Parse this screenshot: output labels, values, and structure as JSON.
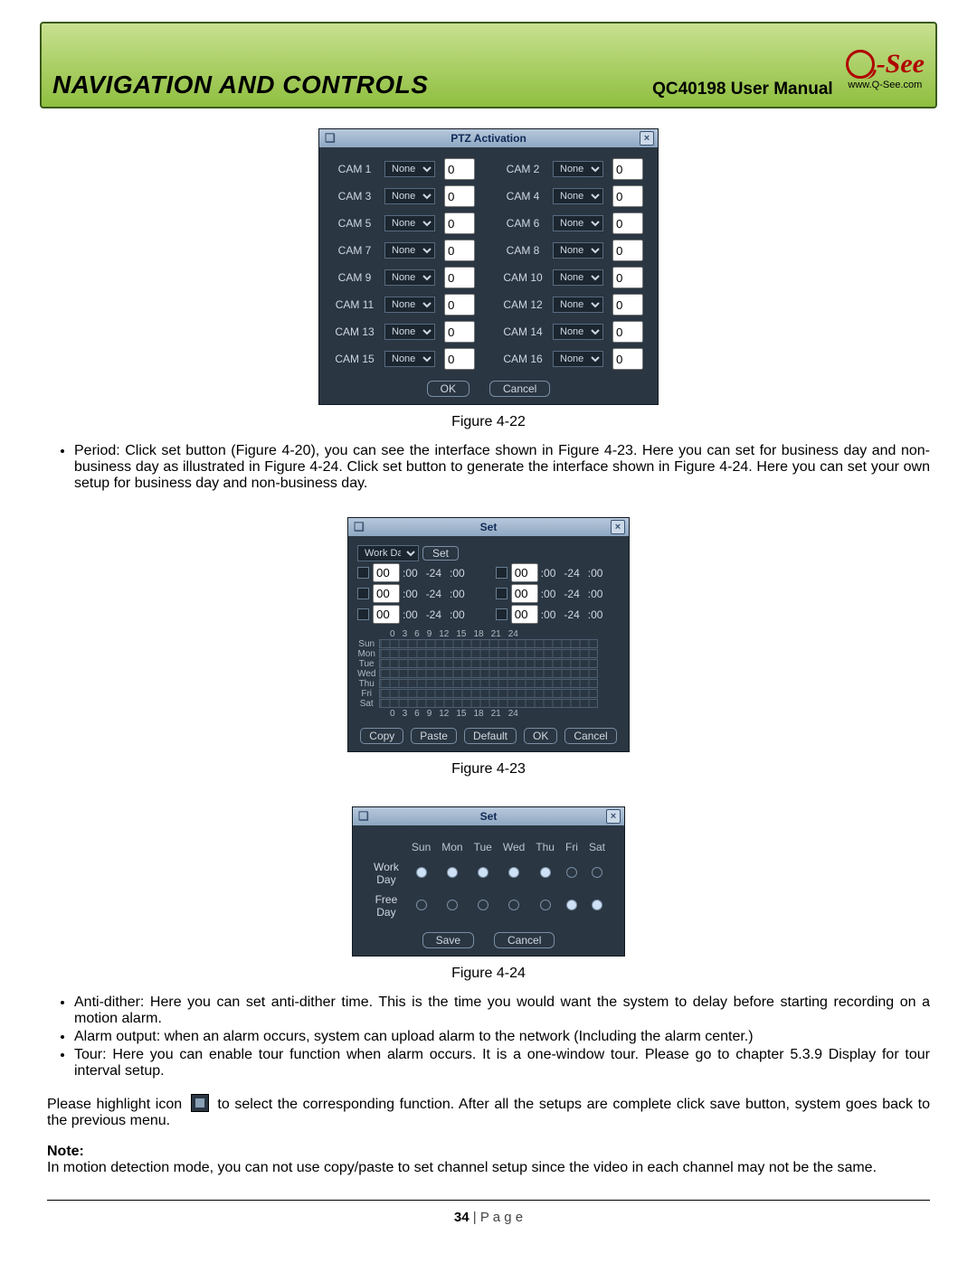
{
  "header": {
    "title": "NAVIGATION AND CONTROLS",
    "subtitle": "QC40198 User Manual",
    "logo_text": "-See",
    "logo_url": "www.Q-See.com"
  },
  "figures": {
    "f1": "Figure 4-22",
    "f2": "Figure 4-23",
    "f3": "Figure 4-24"
  },
  "text": {
    "period_bullet": "Period: Click set button (Figure 4-20), you can see the interface shown in Figure 4-23.  Here you can set for business day and non-business day as illustrated in Figure 4-24.  Click set button to generate the interface shown in Figure 4-24.  Here you can set your own setup for business day and non-business day.",
    "bullet_anti": "Anti-dither: Here you can set anti-dither time. This is the time you would want the system to delay before starting recording on a motion alarm.",
    "bullet_alarm": "Alarm output: when an alarm occurs, system can upload alarm to the network (Including the alarm center.)",
    "bullet_tour": "Tour: Here you can enable tour function when alarm occurs.  It is a one-window tour. Please go to chapter 5.3.9 Display for tour interval setup.",
    "highlight_a": "Please highlight icon ",
    "highlight_b": " to select the corresponding function. After all the setups are complete click save button, system goes back to the previous menu.",
    "note_label": "Note:",
    "note_text": "In motion detection mode, you can not use copy/paste to set channel setup since the video in each channel may not be the same."
  },
  "footer": {
    "num": "34",
    "rest": " | P a g e"
  },
  "ptz": {
    "title": "PTZ Activation",
    "none": "None",
    "zero": "0",
    "ok": "OK",
    "cancel": "Cancel",
    "cams": [
      "CAM 1",
      "CAM 3",
      "CAM 5",
      "CAM 7",
      "CAM 9",
      "CAM 11",
      "CAM 13",
      "CAM 15"
    ],
    "camsr": [
      "CAM 2",
      "CAM 4",
      "CAM 6",
      "CAM 8",
      "CAM 10",
      "CAM 12",
      "CAM 14",
      "CAM 16"
    ]
  },
  "set": {
    "title": "Set",
    "workday": "Work Day",
    "setbtn": "Set",
    "hr": "00",
    "mn": ":00",
    "divider": "-24",
    "axis": [
      "0",
      "3",
      "6",
      "9",
      "12",
      "15",
      "18",
      "21",
      "24"
    ],
    "days": [
      "Sun",
      "Mon",
      "Tue",
      "Wed",
      "Thu",
      "Fri",
      "Sat"
    ],
    "copy": "Copy",
    "paste": "Paste",
    "default": "Default",
    "ok": "OK",
    "cancel": "Cancel"
  },
  "wt": {
    "title": "Set",
    "cols": [
      "Sun",
      "Mon",
      "Tue",
      "Wed",
      "Thu",
      "Fri",
      "Sat"
    ],
    "rows": [
      {
        "label": "Work Day",
        "v": [
          "on",
          "on",
          "on",
          "on",
          "on",
          "off",
          "off"
        ]
      },
      {
        "label": "Free Day",
        "v": [
          "off",
          "off",
          "off",
          "off",
          "off",
          "on",
          "on"
        ]
      }
    ],
    "save": "Save",
    "cancel": "Cancel"
  }
}
